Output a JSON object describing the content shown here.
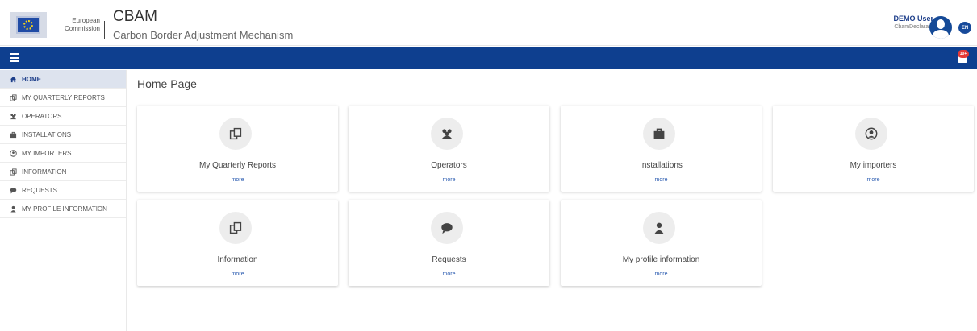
{
  "header": {
    "ec_line1": "European",
    "ec_line2": "Commission",
    "app_title": "CBAM",
    "app_subtitle": "Carbon Border Adjustment Mechanism",
    "user_name": "DEMO User",
    "user_role": "CbamDeclarant",
    "language": "EN"
  },
  "navbar": {
    "notification_badge": "10+"
  },
  "sidebar": {
    "items": [
      {
        "label": "HOME",
        "icon": "home-icon"
      },
      {
        "label": "MY QUARTERLY REPORTS",
        "icon": "copy-icon"
      },
      {
        "label": "OPERATORS",
        "icon": "users-icon"
      },
      {
        "label": "INSTALLATIONS",
        "icon": "briefcase-icon"
      },
      {
        "label": "MY IMPORTERS",
        "icon": "user-circle-icon"
      },
      {
        "label": "INFORMATION",
        "icon": "copy-icon"
      },
      {
        "label": "REQUESTS",
        "icon": "comment-icon"
      },
      {
        "label": "MY PROFILE INFORMATION",
        "icon": "user-icon"
      }
    ]
  },
  "main": {
    "page_title": "Home Page",
    "cards": [
      {
        "label": "My Quarterly Reports",
        "more": "more",
        "icon": "copy-icon"
      },
      {
        "label": "Operators",
        "more": "more",
        "icon": "users-icon"
      },
      {
        "label": "Installations",
        "more": "more",
        "icon": "briefcase-icon"
      },
      {
        "label": "My importers",
        "more": "more",
        "icon": "user-circle-icon"
      },
      {
        "label": "Information",
        "more": "more",
        "icon": "copy-icon"
      },
      {
        "label": "Requests",
        "more": "more",
        "icon": "comment-icon"
      },
      {
        "label": "My profile information",
        "more": "more",
        "icon": "user-icon"
      }
    ]
  },
  "colors": {
    "brand_blue": "#0e3f8f",
    "link_blue": "#2a5bb0",
    "active_bg": "#dde3ee"
  }
}
